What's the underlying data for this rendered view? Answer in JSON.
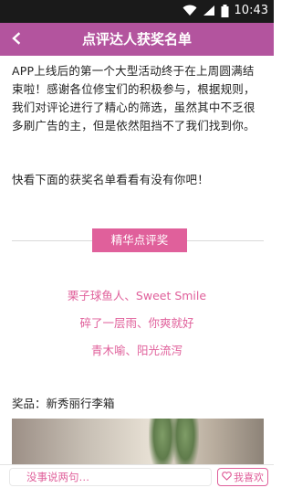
{
  "status_bar": {
    "time": "10:43"
  },
  "app_bar": {
    "title": "点评达人获奖名单",
    "back_icon": "chevron-left-icon"
  },
  "article": {
    "intro": "APP上线后的第一个大型活动终于在上周圆满结束啦！感谢各位修宝们的积极参与，根据规则，我们对评论进行了精心的筛选，虽然其中不乏很多刷广告的主，但是依然阻挡不了我们找到你。",
    "call_to_action": "快看下面的获奖名单看看有没有你吧！",
    "section_tag": "精华点评奖",
    "winners": [
      "栗子球鱼人、Sweet Smile",
      "碎了一层雨、你爽就好",
      "青木喻、阳光流泻"
    ],
    "prize": "奖品：新秀丽行李箱"
  },
  "bottom_bar": {
    "comment_placeholder": "没事说两句…",
    "like_label": "我喜欢",
    "like_icon": "heart-outline-icon"
  },
  "colors": {
    "accent": "#b3549e",
    "pink": "#e0609b"
  }
}
